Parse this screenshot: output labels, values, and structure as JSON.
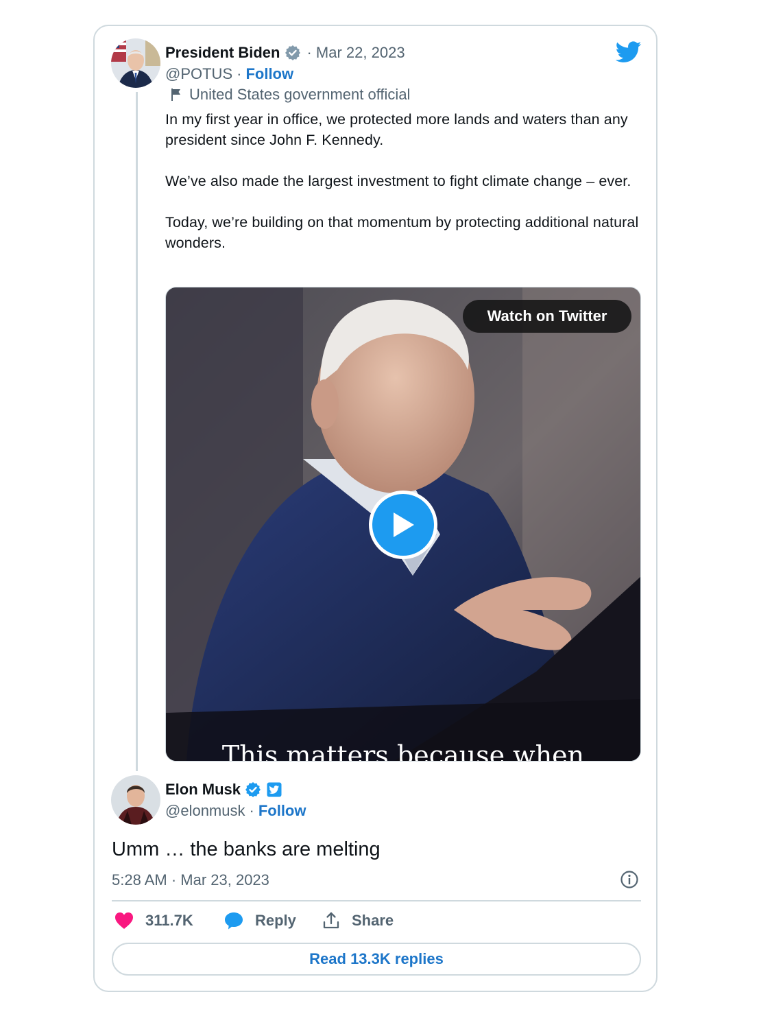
{
  "quoted_tweet": {
    "author_name": "President Biden",
    "date": "· Mar 22, 2023",
    "handle": "@POTUS",
    "separator": "·",
    "follow_label": "Follow",
    "label_text": "United States government official",
    "text": "In my first year in office, we protected more lands and waters than any president since John F. Kennedy.\n\nWe’ve also made the largest investment to fight climate change – ever.\n\nToday, we’re building on that momentum by protecting additional natural wonders.",
    "media": {
      "watch_label": "Watch on Twitter",
      "caption": "This matters because when"
    }
  },
  "reply_tweet": {
    "author_name": "Elon Musk",
    "handle": "@elonmusk",
    "separator": "·",
    "follow_label": "Follow",
    "text": "Umm … the banks are melting",
    "timestamp": "5:28 AM · Mar 23, 2023"
  },
  "actions": {
    "likes": "311.7K",
    "reply_label": "Reply",
    "share_label": "Share"
  },
  "read_replies_label": "Read 13.3K replies",
  "colors": {
    "accent": "#1d9bf0",
    "link": "#1d76c9",
    "like": "#f91880",
    "border": "#cfd9de",
    "muted": "#536471"
  },
  "icons": [
    "twitter-bird-icon",
    "verified-badge-icon",
    "flag-icon",
    "play-icon",
    "heart-icon",
    "reply-bubble-icon",
    "share-icon",
    "info-icon",
    "twitter-affiliate-badge-icon"
  ]
}
